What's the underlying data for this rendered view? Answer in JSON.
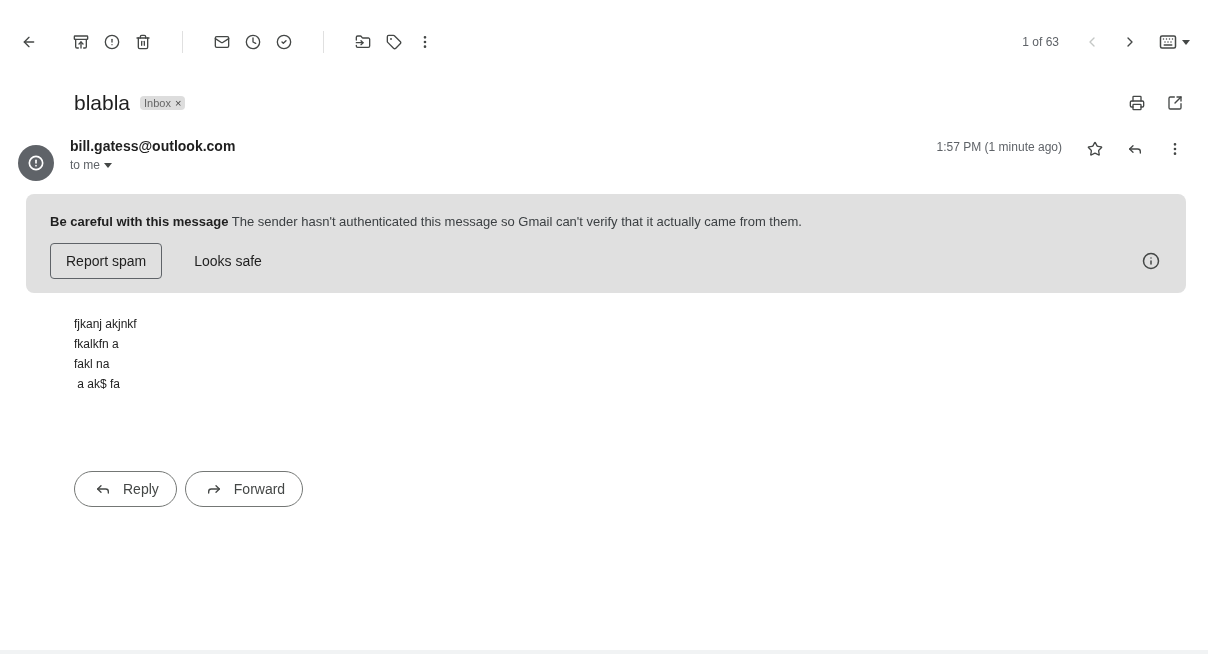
{
  "pager": {
    "label": "1 of 63",
    "prev_disabled": true,
    "next_disabled": false
  },
  "subject": {
    "title": "blabla",
    "label": "Inbox",
    "label_remove": "×"
  },
  "message": {
    "sender": "bill.gatess@outlook.com",
    "recipient": "to me",
    "time": "1:57 PM (1 minute ago)",
    "starred": false
  },
  "warning": {
    "text": "**Be careful with this message** The sender hasn't authenticated this message so Gmail can't verify that it actually came from them.",
    "buttons": [
      {
        "label": "Report spam",
        "kind": "outlined"
      },
      {
        "label": "Looks safe",
        "kind": "text"
      }
    ]
  },
  "body": [
    "fjkanj akjnkf",
    "fkalkfn a",
    "fakl na",
    " a ak$ fa"
  ],
  "actions": [
    {
      "label": "Reply",
      "kind": "reply"
    },
    {
      "label": "Forward",
      "kind": "forward"
    }
  ]
}
